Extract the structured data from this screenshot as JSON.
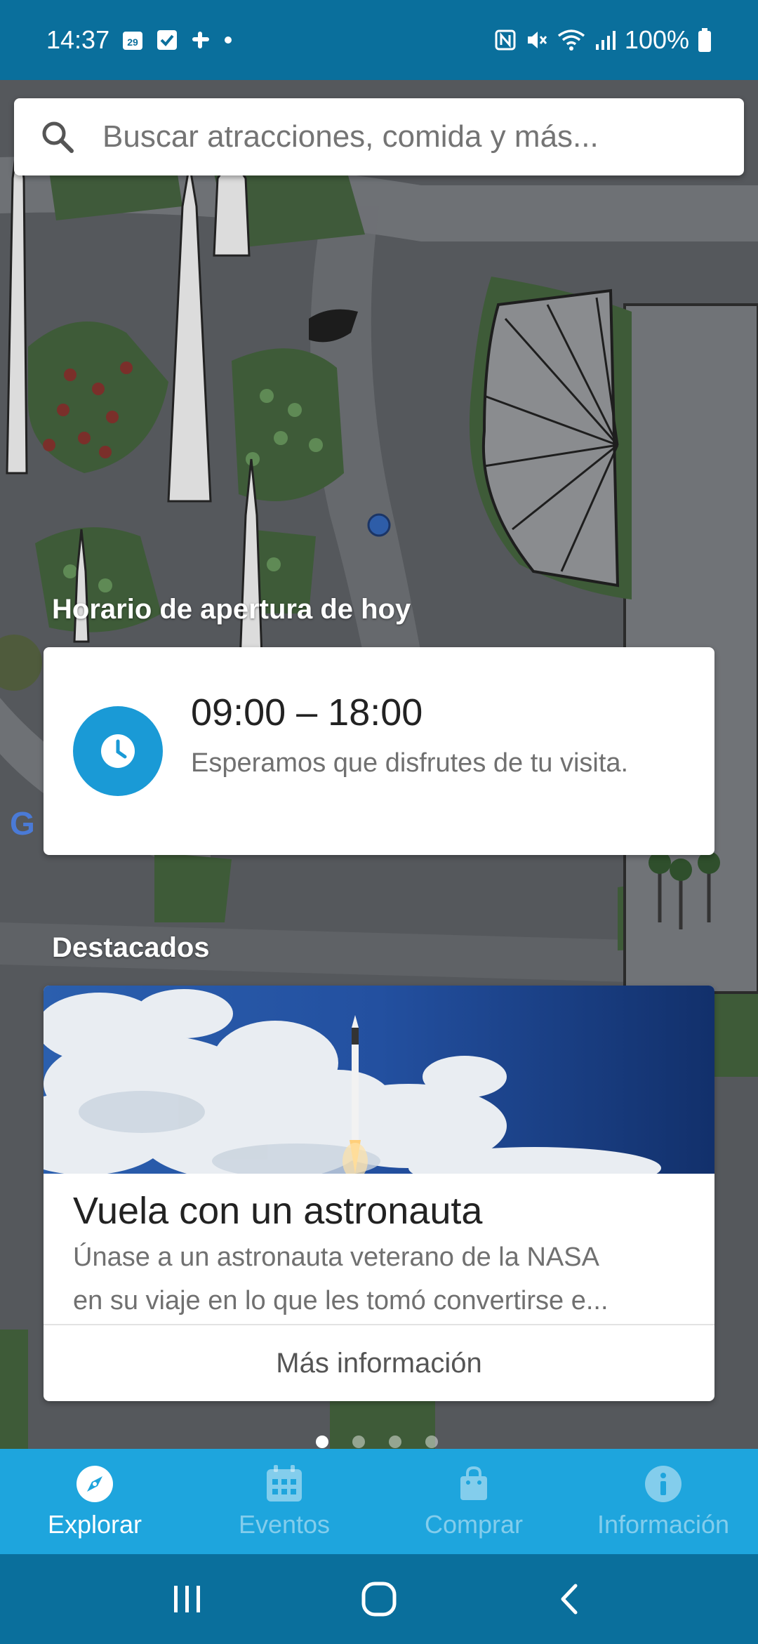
{
  "status_bar": {
    "time": "14:37",
    "calendar_day": "29",
    "battery": "100%"
  },
  "search": {
    "placeholder": "Buscar atracciones, comida y más..."
  },
  "hours": {
    "section_title": "Horario de apertura de hoy",
    "time_range": "09:00 – 18:00",
    "message": "Esperamos que disfrutes de tu visita."
  },
  "featured": {
    "section_title": "Destacados",
    "title": "Vuela con un astronauta",
    "description_line1": "Únase a un astronauta veterano de la NASA",
    "description_line2": "en su viaje en lo que les tomó convertirse e...",
    "more_info_label": "Más información",
    "carousel_count": 4,
    "carousel_active": 1
  },
  "bottom_nav": {
    "items": [
      {
        "label": "Explorar",
        "icon": "compass-icon",
        "active": true
      },
      {
        "label": "Eventos",
        "icon": "calendar-icon",
        "active": false
      },
      {
        "label": "Comprar",
        "icon": "shopping-bag-icon",
        "active": false
      },
      {
        "label": "Información",
        "icon": "info-icon",
        "active": false
      }
    ]
  },
  "colors": {
    "status_bar": "#0a6f9c",
    "accent": "#1ea5dd",
    "clock": "#1a9ad6"
  },
  "map_logo_fragment": "G"
}
